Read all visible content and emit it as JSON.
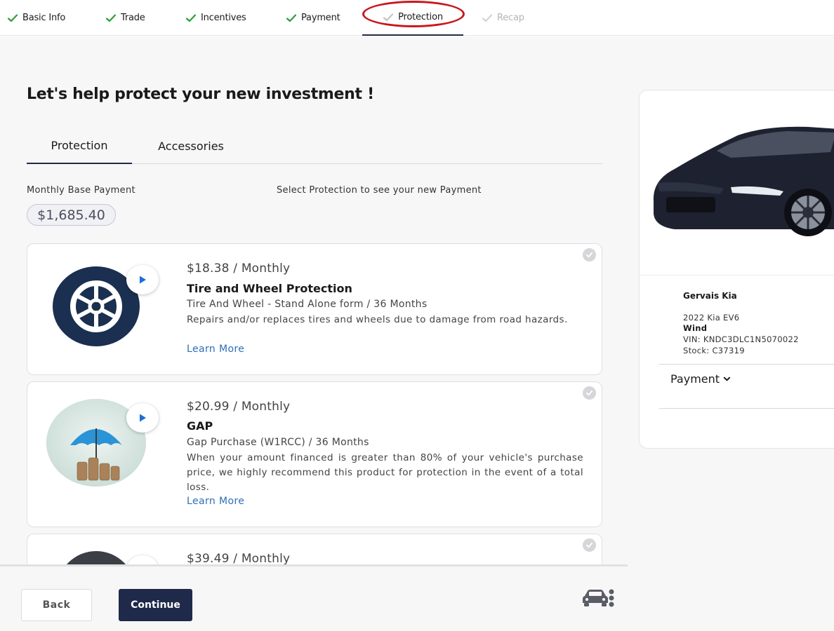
{
  "stepper": {
    "steps": [
      {
        "label": "Basic Info",
        "state": "complete"
      },
      {
        "label": "Trade",
        "state": "complete"
      },
      {
        "label": "Incentives",
        "state": "complete"
      },
      {
        "label": "Payment",
        "state": "complete"
      },
      {
        "label": "Protection",
        "state": "current"
      },
      {
        "label": "Recap",
        "state": "pending"
      }
    ],
    "check_color": "#2e9d3c",
    "pending_check_color": "#c4c4c4",
    "highlight_color": "#c8161d"
  },
  "main": {
    "heading": "Let's help protect your new investment !",
    "tabs": [
      {
        "label": "Protection",
        "active": true
      },
      {
        "label": "Accessories",
        "active": false
      }
    ],
    "base_payment_label": "Monthly Base Payment",
    "select_hint": "Select Protection to see your new Payment",
    "base_payment_value": "$1,685.40"
  },
  "products": [
    {
      "price": "$18.38 / Monthly",
      "title": "Tire and Wheel Protection",
      "subtitle": "Tire And Wheel - Stand Alone form / 36 Months",
      "description": "Repairs and/or replaces tires and wheels due to damage from road hazards.",
      "link": "Learn More",
      "icon": "tire-wheel-icon"
    },
    {
      "price": "$20.99 / Monthly",
      "title": "GAP",
      "subtitle": "Gap Purchase (W1RCC) / 36 Months",
      "description": "When your amount financed is greater than 80% of your vehicle's purchase price, we highly recommend this product for protection in the event of a total loss.",
      "link": "Learn More",
      "icon": "umbrella-coins-image"
    },
    {
      "price": "$39.49 / Monthly",
      "icon": "product-image"
    }
  ],
  "vehicle": {
    "dealer": "Gervais Kia",
    "model": "2022 Kia EV6",
    "trim": "Wind",
    "vin": "VIN: KNDC3DLC1N5070022",
    "stock": "Stock: C37319",
    "payment_toggle": "Payment"
  },
  "footer": {
    "back_label": "Back",
    "continue_label": "Continue"
  },
  "colors": {
    "navy": "#1f2a4a",
    "link_blue": "#2f6fb7",
    "play_blue": "#1d6ed8"
  }
}
